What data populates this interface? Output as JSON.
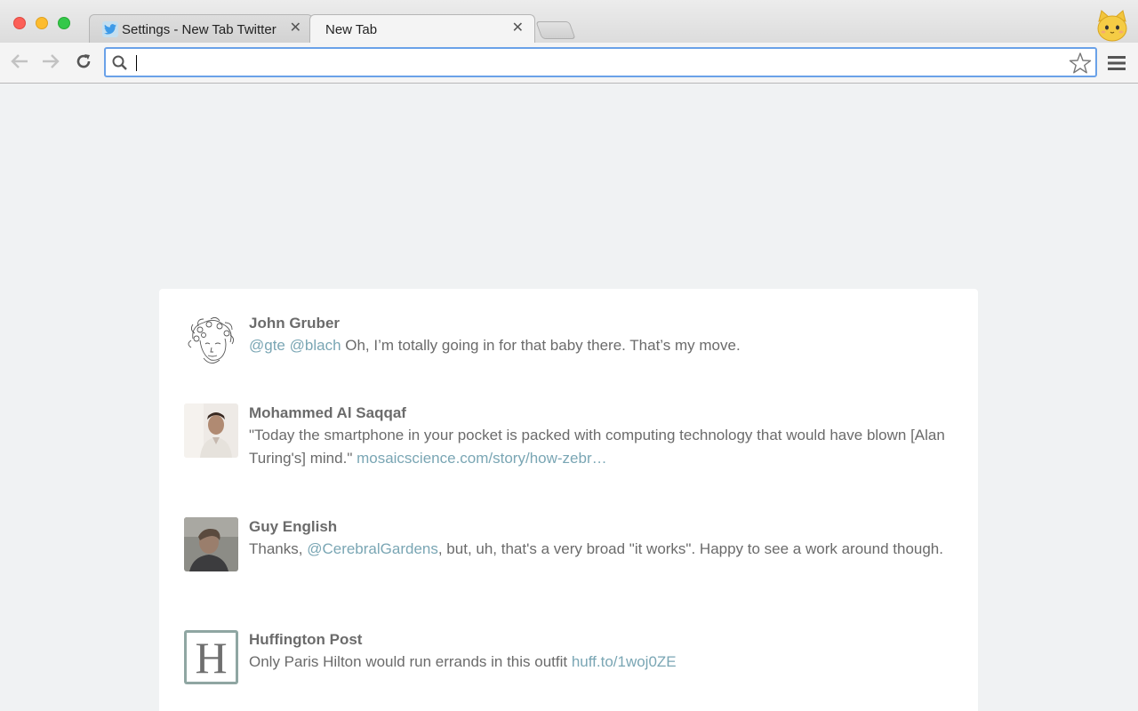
{
  "window": {
    "traffic_lights": [
      "close",
      "minimize",
      "zoom"
    ]
  },
  "tabs": [
    {
      "label": "Settings - New Tab Twitter",
      "icon": "twitter-bird-icon",
      "active": false
    },
    {
      "label": "New Tab",
      "active": true
    }
  ],
  "toolbar": {
    "omnibox_value": "",
    "accent_color": "#6aa1e8"
  },
  "tweets": [
    {
      "name": "John Gruber",
      "avatar": "sketch-portrait",
      "parts": [
        {
          "text": "@gte",
          "link": true
        },
        {
          "text": " ",
          "link": false
        },
        {
          "text": "@blach",
          "link": true
        },
        {
          "text": " Oh, I’m totally going in for that baby there. That’s my move.",
          "link": false
        }
      ]
    },
    {
      "name": "Mohammed Al Saqqaf",
      "avatar": "photo-portrait-light",
      "parts": [
        {
          "text": "\"Today the smartphone in your pocket is packed with computing technology that would have blown [Alan Turing's] mind.\" ",
          "link": false
        },
        {
          "text": "mosaicscience.com/story/how-zebr…",
          "link": true
        }
      ]
    },
    {
      "name": "Guy English",
      "avatar": "photo-portrait-dark",
      "parts": [
        {
          "text": "Thanks, ",
          "link": false
        },
        {
          "text": "@CerebralGardens",
          "link": true
        },
        {
          "text": ", but, uh, that's a very broad \"it works\". Happy to see a work around though.",
          "link": false
        }
      ]
    },
    {
      "name": "Huffington Post",
      "avatar": "letter-H-logo",
      "avatar_letter": "H",
      "parts": [
        {
          "text": "Only Paris Hilton would run errands in this outfit ",
          "link": false
        },
        {
          "text": "huff.to/1woj0ZE",
          "link": true
        }
      ]
    }
  ]
}
